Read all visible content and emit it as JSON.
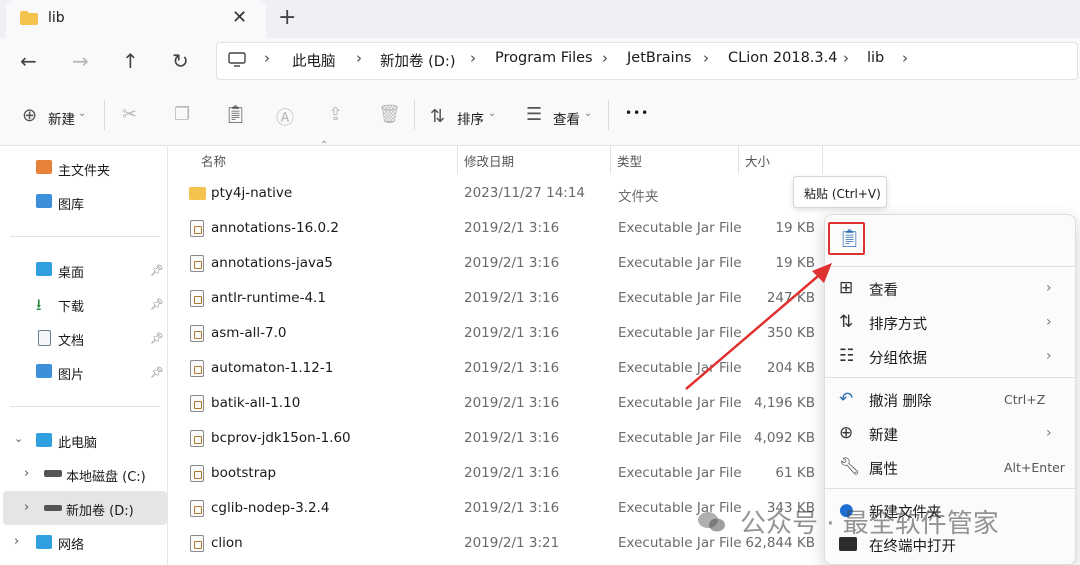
{
  "window": {
    "tab_title": "lib",
    "close_glyph": "✕",
    "new_tab_glyph": "+"
  },
  "nav": {
    "back": "←",
    "forward": "→",
    "up": "↑",
    "refresh": "↻"
  },
  "breadcrumb": [
    "此电脑",
    "新加卷 (D:)",
    "Program Files",
    "JetBrains",
    "CLion 2018.3.4",
    "lib"
  ],
  "toolbar": {
    "new_label": "新建",
    "sort_label": "排序",
    "view_label": "查看",
    "more_glyph": "•••"
  },
  "sidebar": {
    "home": "主文件夹",
    "gallery": "图库",
    "desktop": "桌面",
    "downloads": "下载",
    "documents": "文档",
    "pictures": "图片",
    "this_pc": "此电脑",
    "local_c": "本地磁盘 (C:)",
    "new_volume_d": "新加卷 (D:)",
    "network": "网络"
  },
  "columns": {
    "name": "名称",
    "modified": "修改日期",
    "type": "类型",
    "size": "大小"
  },
  "files": [
    {
      "name": "pty4j-native",
      "date": "2023/11/27 14:14",
      "type": "文件夹",
      "size": "",
      "kind": "folder"
    },
    {
      "name": "annotations-16.0.2",
      "date": "2019/2/1 3:16",
      "type": "Executable Jar File",
      "size": "19 KB",
      "kind": "jar"
    },
    {
      "name": "annotations-java5",
      "date": "2019/2/1 3:16",
      "type": "Executable Jar File",
      "size": "19 KB",
      "kind": "jar"
    },
    {
      "name": "antlr-runtime-4.1",
      "date": "2019/2/1 3:16",
      "type": "Executable Jar File",
      "size": "247 KB",
      "kind": "jar"
    },
    {
      "name": "asm-all-7.0",
      "date": "2019/2/1 3:16",
      "type": "Executable Jar File",
      "size": "350 KB",
      "kind": "jar"
    },
    {
      "name": "automaton-1.12-1",
      "date": "2019/2/1 3:16",
      "type": "Executable Jar File",
      "size": "204 KB",
      "kind": "jar"
    },
    {
      "name": "batik-all-1.10",
      "date": "2019/2/1 3:16",
      "type": "Executable Jar File",
      "size": "4,196 KB",
      "kind": "jar"
    },
    {
      "name": "bcprov-jdk15on-1.60",
      "date": "2019/2/1 3:16",
      "type": "Executable Jar File",
      "size": "4,092 KB",
      "kind": "jar"
    },
    {
      "name": "bootstrap",
      "date": "2019/2/1 3:16",
      "type": "Executable Jar File",
      "size": "61 KB",
      "kind": "jar"
    },
    {
      "name": "cglib-nodep-3.2.4",
      "date": "2019/2/1 3:16",
      "type": "Executable Jar File",
      "size": "343 KB",
      "kind": "jar"
    },
    {
      "name": "clion",
      "date": "2019/2/1 3:21",
      "type": "Executable Jar File",
      "size": "62,844 KB",
      "kind": "jar"
    }
  ],
  "tooltip": "粘贴 (Ctrl+V)",
  "context_menu": {
    "view": "查看",
    "sort_by": "排序方式",
    "group_by": "分组依据",
    "undo_delete": "撤消 删除",
    "undo_shortcut": "Ctrl+Z",
    "new": "新建",
    "properties": "属性",
    "properties_shortcut": "Alt+Enter",
    "new_folder": "新建文件夹",
    "open_in_terminal": "在终端中打开"
  },
  "watermark": "公众号 · 最全软件管家",
  "colors": {
    "accent": "#2b6cb0",
    "highlight_red": "#e03131",
    "folder_yellow": "#f3c34d"
  }
}
